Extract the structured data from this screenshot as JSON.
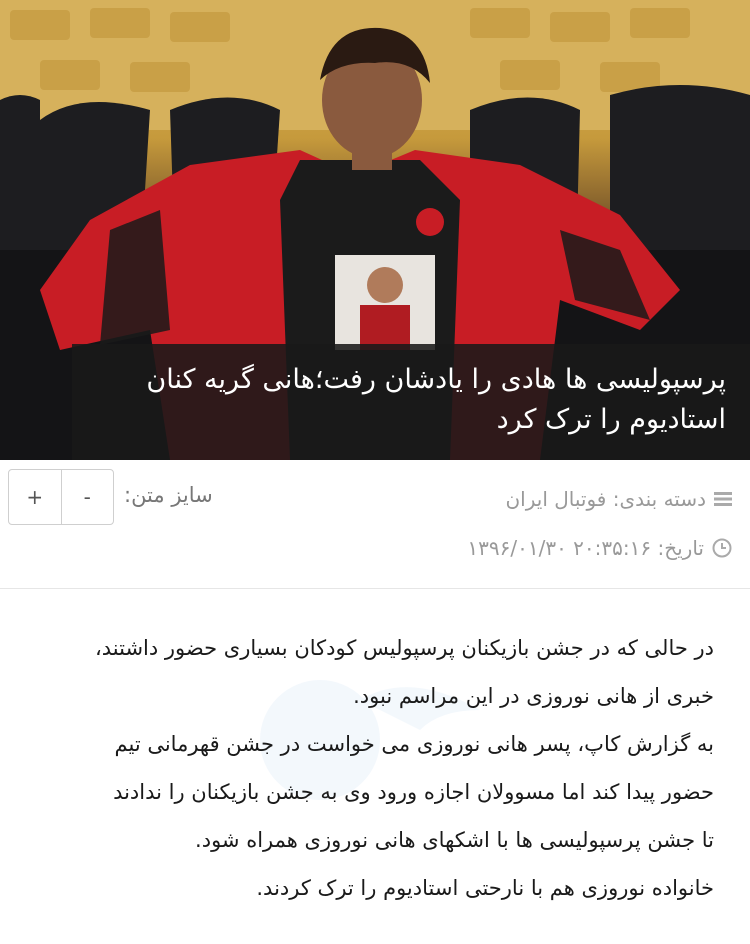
{
  "article": {
    "title": "پرسپولیسی ها هادی را یادشان رفت؛هانی گریه کنان استادیوم را ترک کرد",
    "image_alt": "boy-in-persepolis-jacket-photo"
  },
  "meta": {
    "category_label": "دسته بندی: فوتبال ایران",
    "date_label": "تاریخ: ۲۰:۳۵:۱۶ ۱۳۹۶/۰۱/۳۰",
    "text_size_label": "سایز متن:",
    "increase_label": "+",
    "decrease_label": "-"
  },
  "body": {
    "lines": [
      "در حالی که در جشن بازیکنان پرسپولیس کودکان بسیاری حضور داشتند،",
      "خبری از هانی نوروزی در این مراسم نبود.",
      "به گزارش کاپ، پسر هانی نوروزی می خواست در جشن قهرمانی تیم",
      "حضور پیدا کند اما مسوولان اجازه ورود وی به جشن بازیکنان را ندادند",
      "تا جشن پرسپولیسی ها با اشکهای هانی نوروزی همراه شود.",
      "خانواده نوروزی هم با نارحتی استادیوم را ترک کردند."
    ]
  },
  "colors": {
    "jacket_red": "#c81d25",
    "title_bg": "#191919",
    "meta_text": "#999999"
  }
}
